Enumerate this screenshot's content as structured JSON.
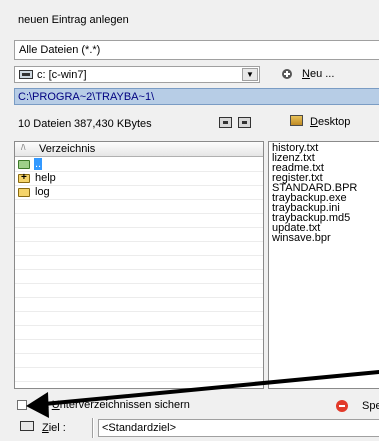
{
  "dialog": {
    "title": "neuen Eintrag anlegen"
  },
  "filter": {
    "value": "Alle Dateien (*.*)"
  },
  "drive": {
    "value": "c: [c-win7]",
    "dropdown_glyph": "▼"
  },
  "new_button": {
    "label_prefix": "",
    "label_u": "N",
    "label_rest": "eu ..."
  },
  "path": {
    "value": "C:\\PROGRA~2\\TRAYBA~1\\"
  },
  "status": {
    "file_count": "10 Dateien",
    "size": "387,430 KBytes"
  },
  "desktop_button": {
    "label_u": "D",
    "label_rest": "esktop"
  },
  "directory": {
    "header": "Verzeichnis",
    "sort_glyph": "/\\",
    "items": [
      {
        "name": "..",
        "icon": "folder-up-icon"
      },
      {
        "name": "help",
        "icon": "folder-plus-icon"
      },
      {
        "name": "log",
        "icon": "folder-icon"
      }
    ]
  },
  "files": [
    "history.txt",
    "lizenz.txt",
    "readme.txt",
    "register.txt",
    "STANDARD.BPR",
    "traybackup.exe",
    "traybackup.ini",
    "traybackup.md5",
    "update.txt",
    "winsave.bpr"
  ],
  "subfolders": {
    "label_prefix": "mit ",
    "label_u": "U",
    "label_rest": "nterverzeichnissen sichern",
    "checked": false
  },
  "stop_button": {
    "label": "Spe"
  },
  "target": {
    "label_u": "Z",
    "label_rest": "iel :",
    "value": "<Standardziel>"
  },
  "colors": {
    "path_bar": "#b7cde6",
    "selection": "#3399ff",
    "arrow": "#000000"
  }
}
